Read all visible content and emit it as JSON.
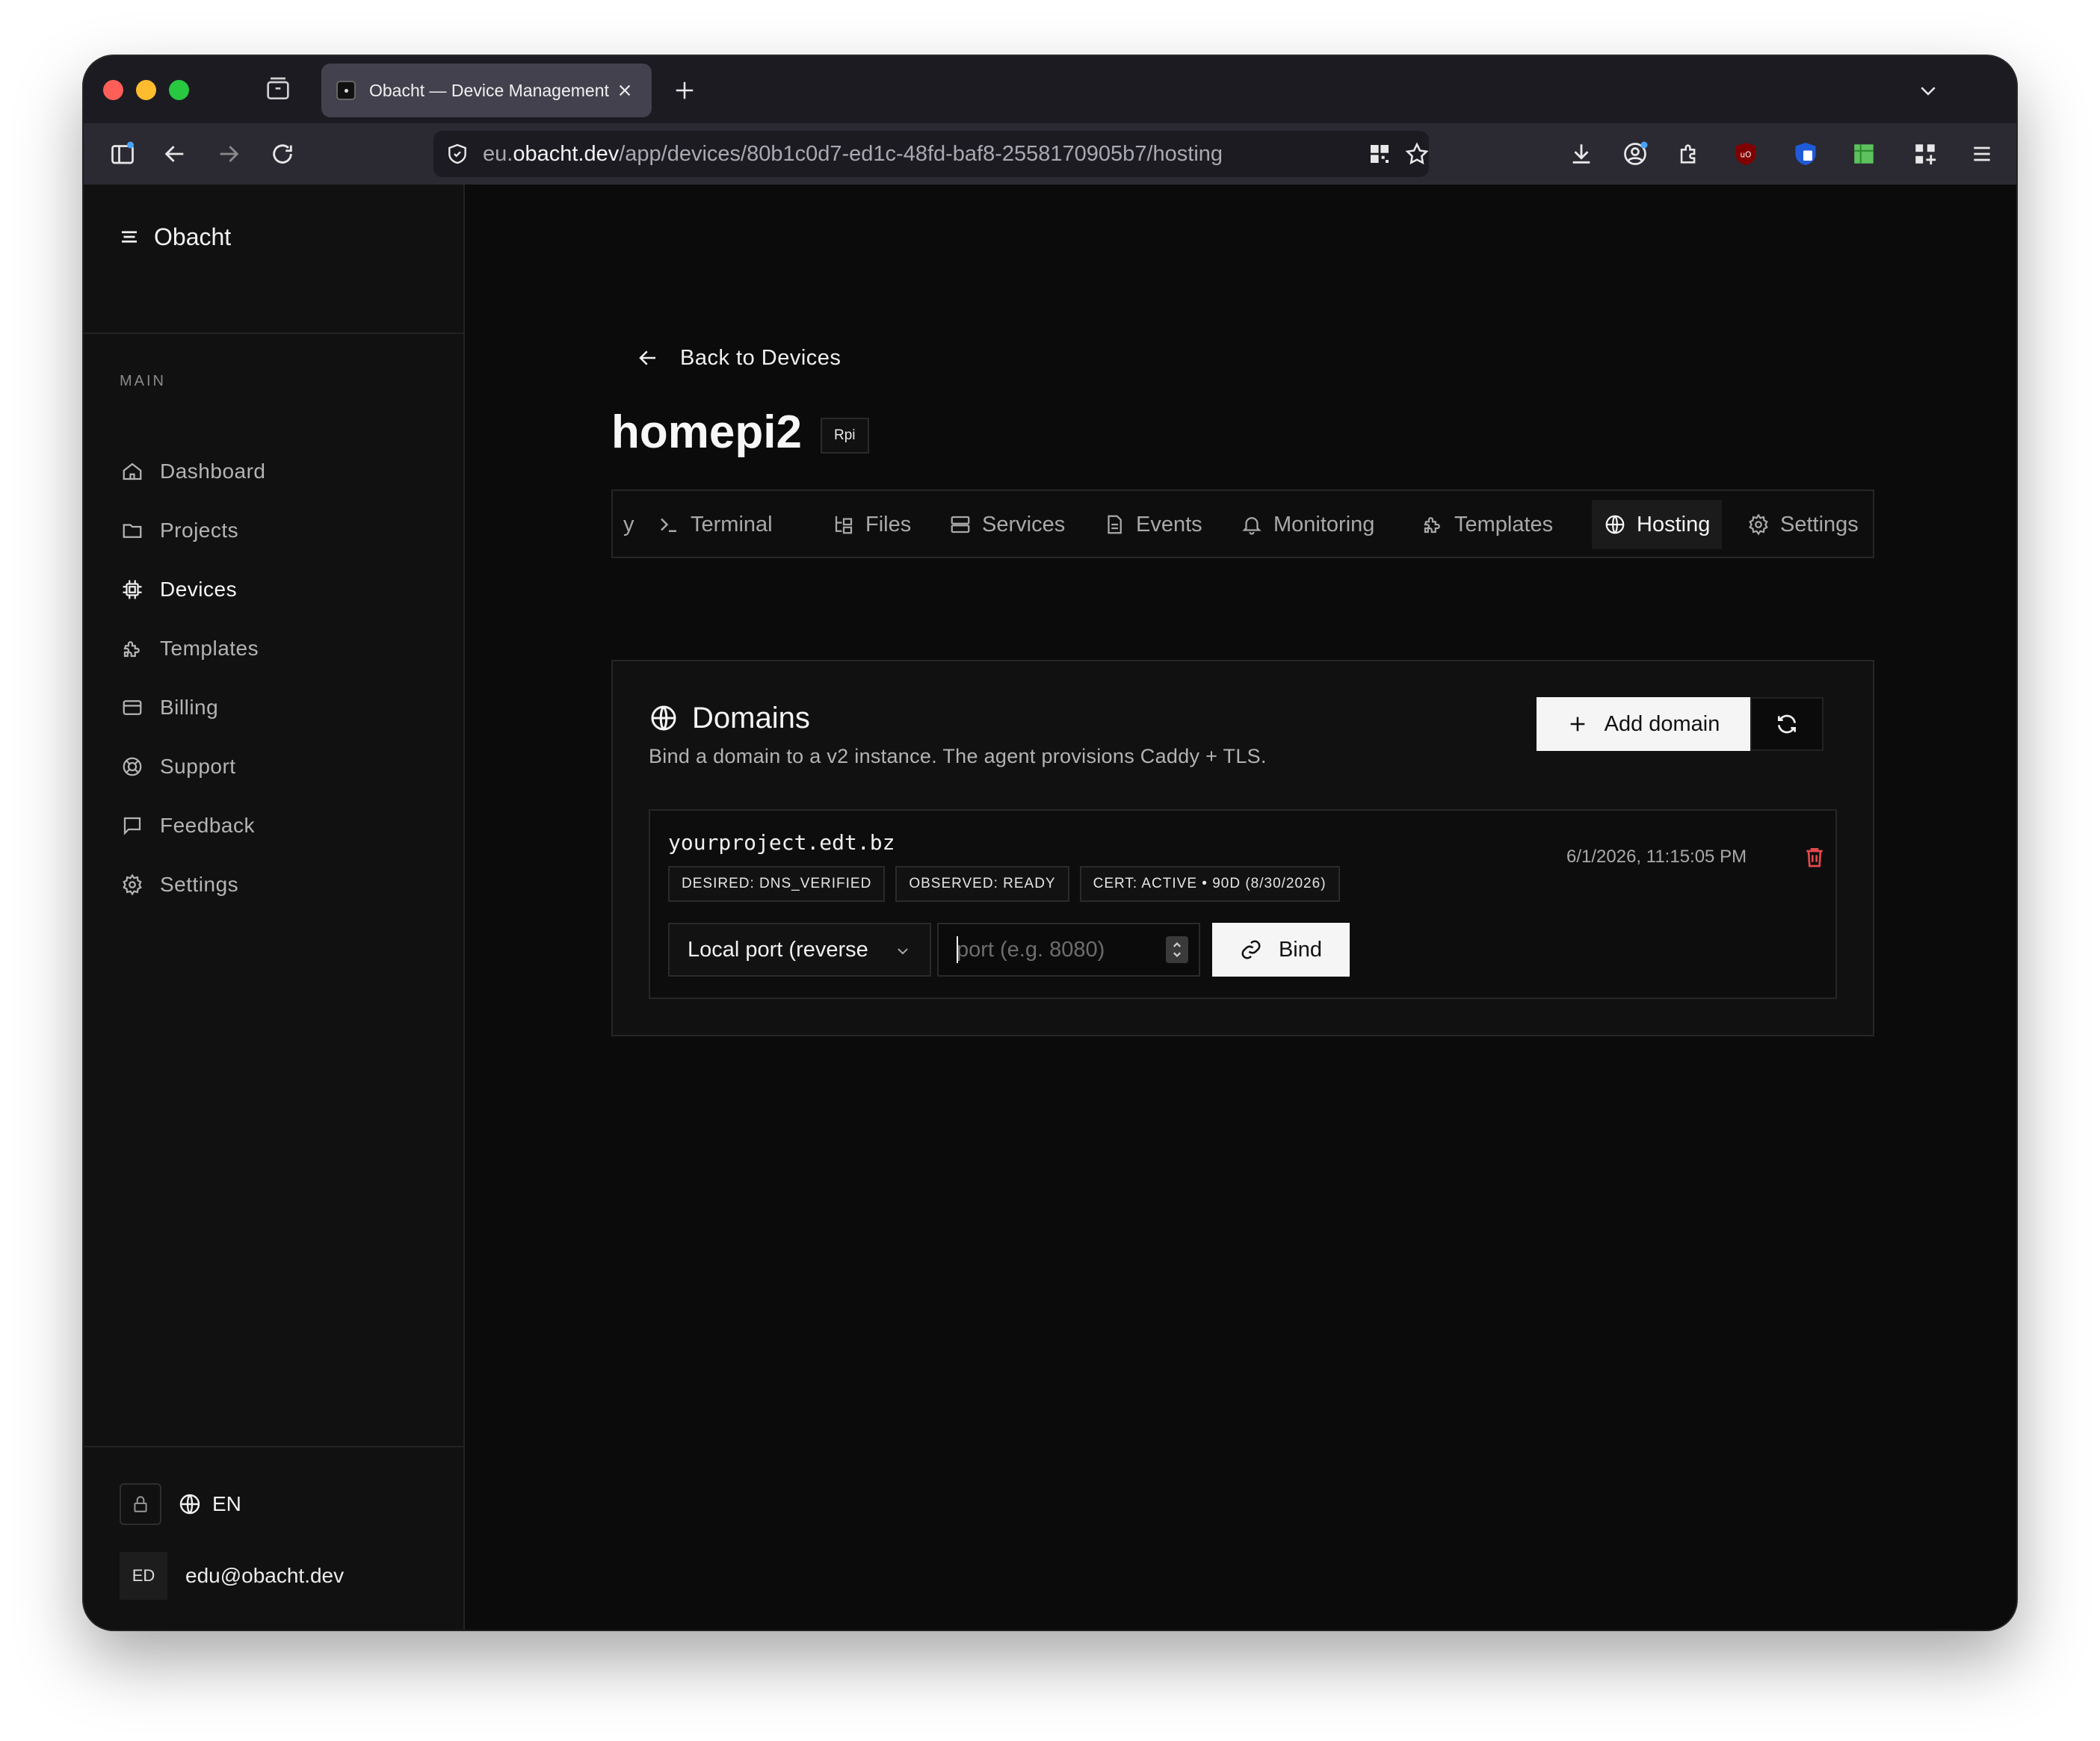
{
  "browser": {
    "tab_title": "Obacht — Device Management",
    "url_prefix": "eu.",
    "url_domain": "obacht.dev",
    "url_path": "/app/devices/80b1c0d7-ed1c-48fd-baf8-2558170905b7/hosting"
  },
  "sidebar": {
    "brand": "Obacht",
    "section_label": "MAIN",
    "items": [
      {
        "label": "Dashboard",
        "icon": "home-icon"
      },
      {
        "label": "Projects",
        "icon": "folder-icon"
      },
      {
        "label": "Devices",
        "icon": "chip-icon",
        "active": true
      },
      {
        "label": "Templates",
        "icon": "puzzle-icon"
      },
      {
        "label": "Billing",
        "icon": "credit-card-icon"
      },
      {
        "label": "Support",
        "icon": "lifebuoy-icon"
      },
      {
        "label": "Feedback",
        "icon": "message-icon"
      },
      {
        "label": "Settings",
        "icon": "gear-icon"
      }
    ],
    "language": "EN",
    "user_initials": "ED",
    "user_email": "edu@obacht.dev"
  },
  "page": {
    "back_label": "Back to Devices",
    "device_name": "homepi2",
    "device_badge": "Rpi",
    "tabs": [
      {
        "label": "y",
        "icon": ""
      },
      {
        "label": "Terminal",
        "icon": "terminal-icon"
      },
      {
        "label": "Files",
        "icon": "folder-tree-icon"
      },
      {
        "label": "Services",
        "icon": "server-icon"
      },
      {
        "label": "Events",
        "icon": "file-text-icon"
      },
      {
        "label": "Monitoring",
        "icon": "bell-icon"
      },
      {
        "label": "Templates",
        "icon": "puzzle-icon"
      },
      {
        "label": "Hosting",
        "icon": "globe-icon",
        "active": true
      },
      {
        "label": "Settings",
        "icon": "gear-icon"
      }
    ]
  },
  "domains": {
    "title": "Domains",
    "subtitle": "Bind a domain to a v2 instance. The agent provisions Caddy + TLS.",
    "add_label": "Add domain",
    "entries": [
      {
        "domain": "yourproject.edt.bz",
        "badges": [
          "DESIRED: DNS_VERIFIED",
          "OBSERVED: READY",
          "CERT: ACTIVE • 90D (8/30/2026)"
        ],
        "timestamp": "6/1/2026, 11:15:05 PM",
        "target_select": "Local port (reverse",
        "port_value": "",
        "port_placeholder": "port (e.g. 8080)",
        "bind_label": "Bind"
      }
    ]
  },
  "colors": {
    "background": "#0b0b0b",
    "sidebar": "#111111",
    "primary_button": "#f5f5f5",
    "danger": "#e5484d"
  }
}
